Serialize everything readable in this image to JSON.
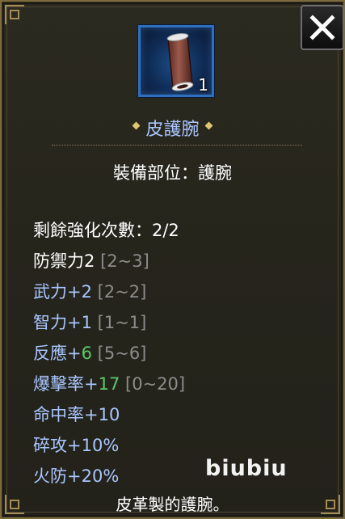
{
  "item": {
    "name": "皮護腕",
    "count": "1",
    "icon": "leather-bracer-icon",
    "slot_label": "裝備部位：護腕",
    "description": "皮革製的護腕。"
  },
  "stats": {
    "enhance": {
      "label": "剩餘強化次數：2/2"
    },
    "defense": {
      "label": "防禦力2",
      "range": "[2~3]"
    },
    "force": {
      "label": "武力+2",
      "range": "[2~2]"
    },
    "intellect": {
      "label": "智力+1",
      "range": "[1~1]"
    },
    "reaction": {
      "label": "反應+",
      "value": "6",
      "range": "[5~6]"
    },
    "critical": {
      "label": "爆擊率+",
      "value": "17",
      "range": "[0~20]"
    },
    "accuracy": {
      "label": "命中率+10"
    },
    "armor_break": {
      "label": "碎攻+10%"
    },
    "fire_resist": {
      "label": "火防+20%"
    }
  },
  "watermark": "biubiu",
  "colors": {
    "bonus_blue": "#a9c6ff",
    "upgrade_green": "#5ec96a",
    "range_grey": "#8c8c8c",
    "frame_gold": "#a58c55"
  }
}
